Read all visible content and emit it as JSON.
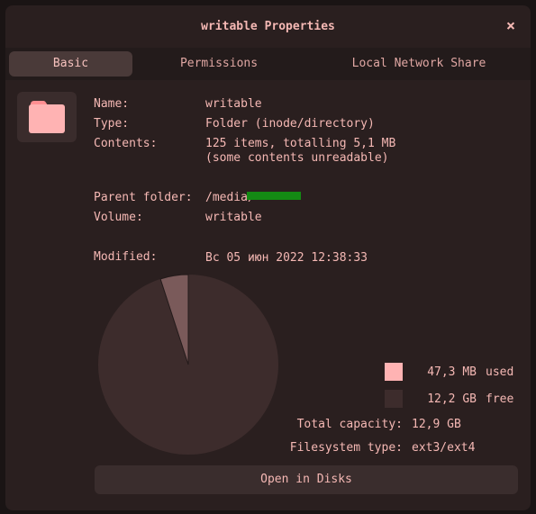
{
  "window": {
    "title": "writable Properties",
    "close_glyph": "×"
  },
  "tabs": [
    {
      "label": "Basic",
      "active": true
    },
    {
      "label": "Permissions",
      "active": false
    },
    {
      "label": "Local Network Share",
      "active": false
    }
  ],
  "icon": {
    "name": "folder-icon",
    "color": "#ffb3b3",
    "tab_color": "#ff8f92"
  },
  "info": {
    "name_label": "Name:",
    "name_value": "writable",
    "type_label": "Type:",
    "type_value": "Folder (inode/directory)",
    "contents_label": "Contents:",
    "contents_value_line1": "125 items, totalling 5,1 MB",
    "contents_value_line2": "(some contents unreadable)",
    "parent_label": "Parent folder:",
    "parent_value": "/media/",
    "volume_label": "Volume:",
    "volume_value": "writable",
    "modified_label": "Modified:",
    "modified_value": "Вс 05 июн 2022 12:38:33"
  },
  "usage": {
    "used_value": "47,3 MB",
    "used_word": "used",
    "used_color": "#ffb3b3",
    "free_value": "12,2 GB",
    "free_word": "free",
    "free_color": "#3d2c2c",
    "used_fraction": 0.05,
    "pie_used_color": "#7a5a5a",
    "pie_free_color": "#3d2c2c",
    "total_label": "Total capacity:",
    "total_value": "12,9 GB",
    "fs_label": "Filesystem type:",
    "fs_value": "ext3/ext4"
  },
  "actions": {
    "open_disks": "Open in Disks"
  }
}
